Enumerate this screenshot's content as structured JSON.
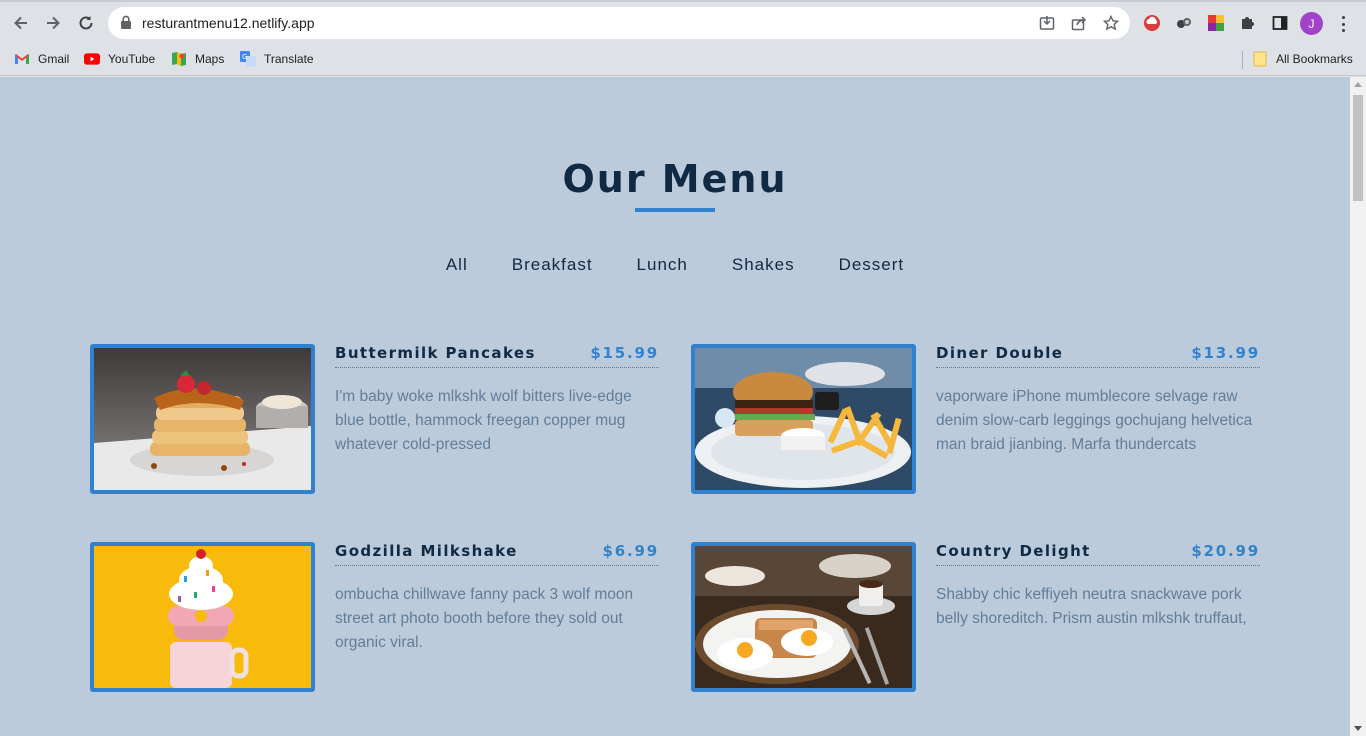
{
  "browser": {
    "url": "resturantmenu12.netlify.app",
    "profile_initial": "J",
    "bookmarks": [
      {
        "label": "Gmail",
        "icon": "gmail-icon"
      },
      {
        "label": "YouTube",
        "icon": "youtube-icon"
      },
      {
        "label": "Maps",
        "icon": "maps-icon"
      },
      {
        "label": "Translate",
        "icon": "translate-icon"
      }
    ],
    "all_bookmarks": "All Bookmarks"
  },
  "menu": {
    "title": "Our Menu",
    "filters": [
      "All",
      "Breakfast",
      "Lunch",
      "Shakes",
      "Dessert"
    ],
    "items": [
      {
        "name": "Buttermilk Pancakes",
        "price": "$15.99",
        "desc": "I'm baby woke mlkshk wolf bitters live-edge blue bottle, hammock freegan copper mug whatever cold-pressed",
        "image": "pancakes"
      },
      {
        "name": "Diner Double",
        "price": "$13.99",
        "desc": "vaporware iPhone mumblecore selvage raw denim slow-carb leggings gochujang helvetica man braid jianbing. Marfa thundercats",
        "image": "burger"
      },
      {
        "name": "Godzilla Milkshake",
        "price": "$6.99",
        "desc": "ombucha chillwave fanny pack 3 wolf moon street art photo booth before they sold out organic viral.",
        "image": "milkshake"
      },
      {
        "name": "Country Delight",
        "price": "$20.99",
        "desc": "Shabby chic keffiyeh neutra snackwave pork belly shoreditch. Prism austin mlkshk truffaut,",
        "image": "eggs-toast"
      }
    ]
  },
  "colors": {
    "page_bg": "#bccbdc",
    "primary": "#3182ce",
    "heading": "#102a43",
    "text": "#617d98"
  }
}
